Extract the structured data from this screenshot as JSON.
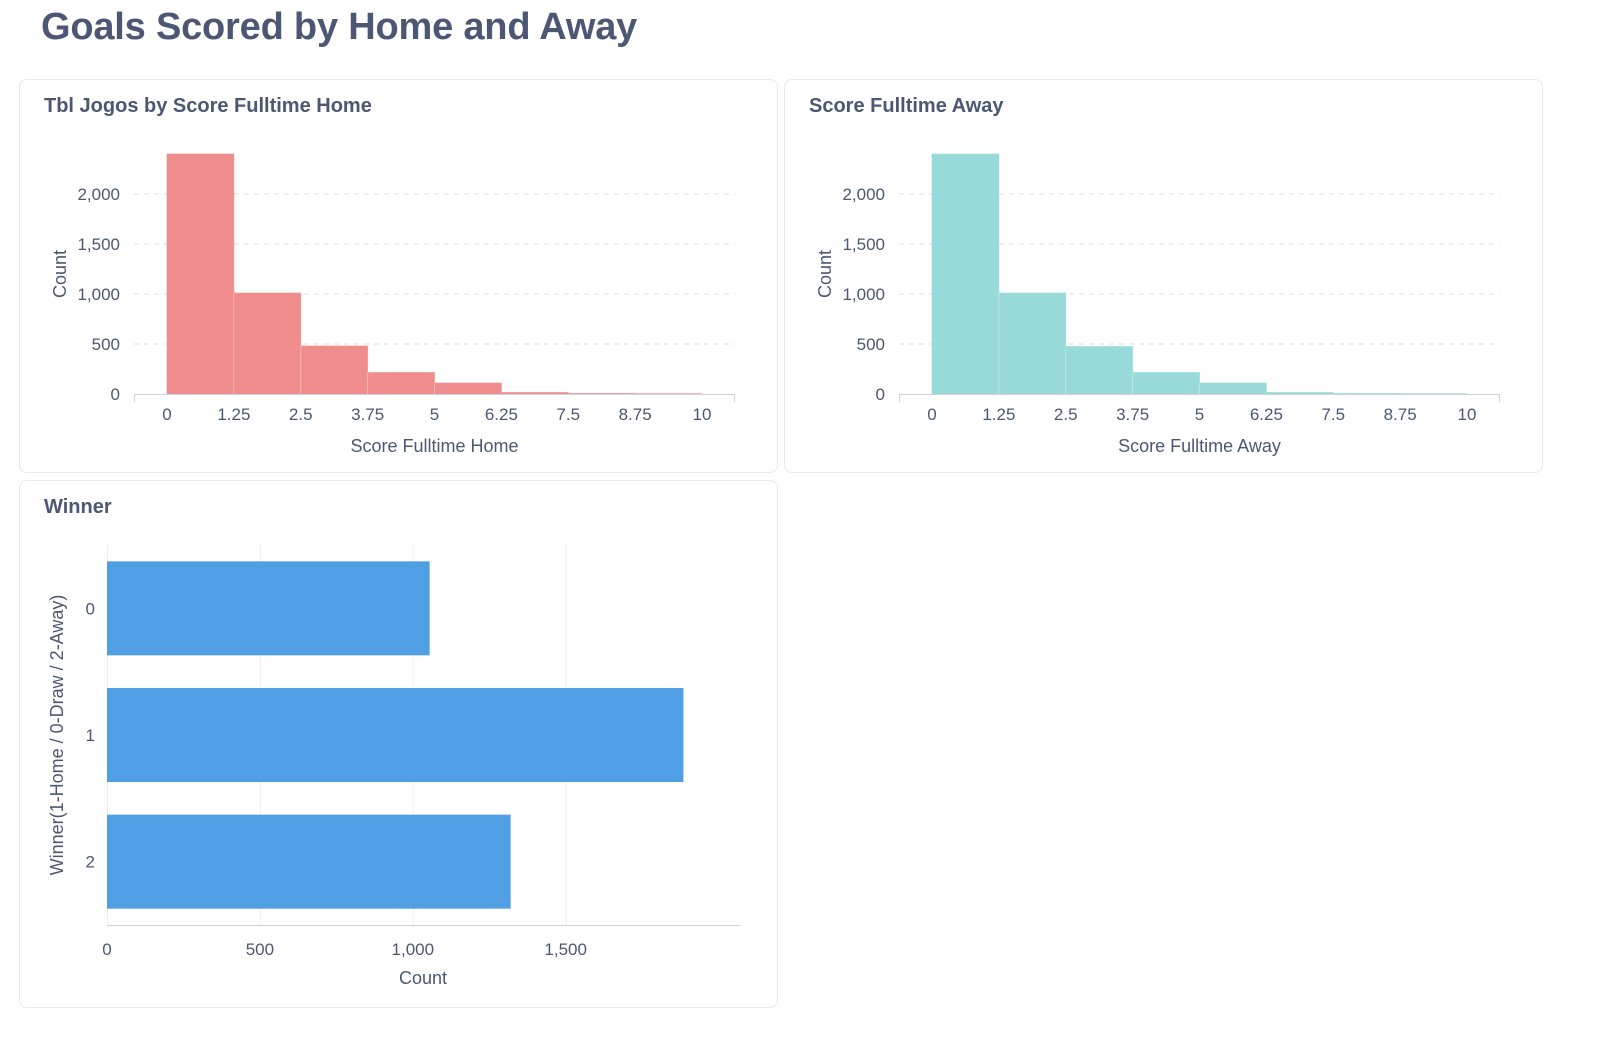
{
  "dashboard": {
    "title": "Goals Scored by Home and Away"
  },
  "colors": {
    "home": "#ef8c8c",
    "away": "#98d9d9",
    "winner": "#509ee3",
    "grid": "#dcdfe4",
    "axis": "#cfd3d9",
    "text": "#4c5773"
  },
  "chart_data": [
    {
      "type": "bar",
      "title": "Tbl Jogos by Score Fulltime Home",
      "xlabel": "Score Fulltime Home",
      "ylabel": "Count",
      "bin_width": 1.25,
      "bins": [
        {
          "start": 0,
          "end": 1.25,
          "value": 2400
        },
        {
          "start": 1.25,
          "end": 2.5,
          "value": 1010
        },
        {
          "start": 2.5,
          "end": 3.75,
          "value": 480
        },
        {
          "start": 3.75,
          "end": 5,
          "value": 215
        },
        {
          "start": 5,
          "end": 6.25,
          "value": 110
        },
        {
          "start": 6.25,
          "end": 7.5,
          "value": 15
        },
        {
          "start": 7.5,
          "end": 8.75,
          "value": 5
        },
        {
          "start": 8.75,
          "end": 10,
          "value": 3
        }
      ],
      "x_ticks": [
        "0",
        "1.25",
        "2.5",
        "3.75",
        "5",
        "6.25",
        "7.5",
        "8.75",
        "10"
      ],
      "y_ticks": [
        {
          "value": 0,
          "label": "0"
        },
        {
          "value": 500,
          "label": "500"
        },
        {
          "value": 1000,
          "label": "1,000"
        },
        {
          "value": 1500,
          "label": "1,500"
        },
        {
          "value": 2000,
          "label": "2,000"
        }
      ],
      "xlim": [
        0,
        10
      ],
      "ylim": [
        0,
        2400
      ],
      "grid": true
    },
    {
      "type": "bar",
      "title": "Score Fulltime Away",
      "xlabel": "Score Fulltime Away",
      "ylabel": "Count",
      "bin_width": 1.25,
      "bins": [
        {
          "start": 0,
          "end": 1.25,
          "value": 2400
        },
        {
          "start": 1.25,
          "end": 2.5,
          "value": 1010
        },
        {
          "start": 2.5,
          "end": 3.75,
          "value": 475
        },
        {
          "start": 3.75,
          "end": 5,
          "value": 215
        },
        {
          "start": 5,
          "end": 6.25,
          "value": 110
        },
        {
          "start": 6.25,
          "end": 7.5,
          "value": 15
        },
        {
          "start": 7.5,
          "end": 8.75,
          "value": 5
        },
        {
          "start": 8.75,
          "end": 10,
          "value": 3
        }
      ],
      "x_ticks": [
        "0",
        "1.25",
        "2.5",
        "3.75",
        "5",
        "6.25",
        "7.5",
        "8.75",
        "10"
      ],
      "y_ticks": [
        {
          "value": 0,
          "label": "0"
        },
        {
          "value": 500,
          "label": "500"
        },
        {
          "value": 1000,
          "label": "1,000"
        },
        {
          "value": 1500,
          "label": "1,500"
        },
        {
          "value": 2000,
          "label": "2,000"
        }
      ],
      "xlim": [
        0,
        10
      ],
      "ylim": [
        0,
        2400
      ],
      "grid": true
    },
    {
      "type": "bar",
      "orientation": "horizontal",
      "title": "Winner",
      "xlabel": "Count",
      "ylabel": "Winner(1-Home / 0-Draw / 2-Away)",
      "categories": [
        "0",
        "1",
        "2"
      ],
      "values": [
        1055,
        1885,
        1320
      ],
      "x_ticks": [
        {
          "value": 0,
          "label": "0"
        },
        {
          "value": 500,
          "label": "500"
        },
        {
          "value": 1000,
          "label": "1,000"
        },
        {
          "value": 1500,
          "label": "1,500"
        }
      ],
      "xlim": [
        0,
        2070
      ],
      "grid": true
    }
  ]
}
